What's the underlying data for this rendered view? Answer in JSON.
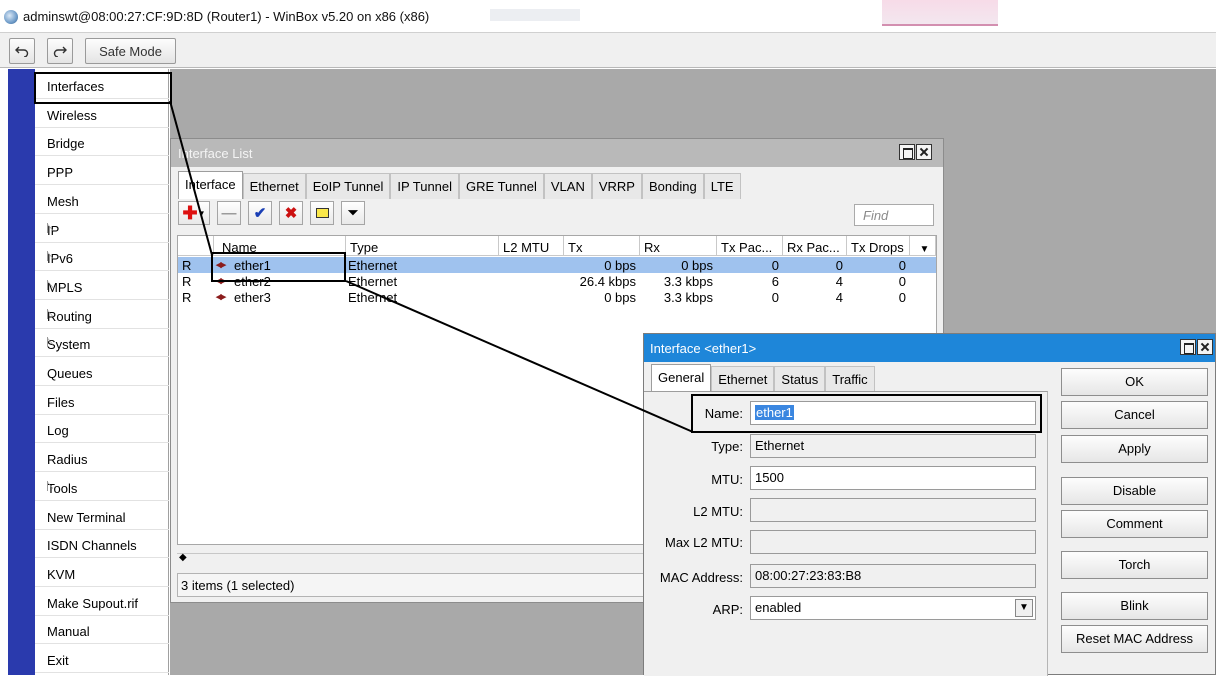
{
  "window": {
    "title": "adminswt@08:00:27:CF:9D:8D (Router1) - WinBox v5.20 on x86 (x86)"
  },
  "toolbar": {
    "undo_icon": "undo-icon",
    "redo_icon": "redo-icon",
    "safe_mode_label": "Safe Mode"
  },
  "sidebar": {
    "items": [
      {
        "label": "Interfaces",
        "submenu": false
      },
      {
        "label": "Wireless",
        "submenu": false
      },
      {
        "label": "Bridge",
        "submenu": false
      },
      {
        "label": "PPP",
        "submenu": false
      },
      {
        "label": "Mesh",
        "submenu": false
      },
      {
        "label": "IP",
        "submenu": true
      },
      {
        "label": "IPv6",
        "submenu": true
      },
      {
        "label": "MPLS",
        "submenu": true
      },
      {
        "label": "Routing",
        "submenu": true
      },
      {
        "label": "System",
        "submenu": true
      },
      {
        "label": "Queues",
        "submenu": false
      },
      {
        "label": "Files",
        "submenu": false
      },
      {
        "label": "Log",
        "submenu": false
      },
      {
        "label": "Radius",
        "submenu": false
      },
      {
        "label": "Tools",
        "submenu": true
      },
      {
        "label": "New Terminal",
        "submenu": false
      },
      {
        "label": "ISDN Channels",
        "submenu": false
      },
      {
        "label": "KVM",
        "submenu": false
      },
      {
        "label": "Make Supout.rif",
        "submenu": false
      },
      {
        "label": "Manual",
        "submenu": false
      },
      {
        "label": "Exit",
        "submenu": false
      }
    ]
  },
  "interface_list": {
    "title": "Interface List",
    "tabs": [
      "Interface",
      "Ethernet",
      "EoIP Tunnel",
      "IP Tunnel",
      "GRE Tunnel",
      "VLAN",
      "VRRP",
      "Bonding",
      "LTE"
    ],
    "find_placeholder": "Find",
    "columns": [
      "Name",
      "Type",
      "L2 MTU",
      "Tx",
      "Rx",
      "Tx Pac...",
      "Rx Pac...",
      "Tx Drops"
    ],
    "rows": [
      {
        "flag": "R",
        "name": "ether1",
        "type": "Ethernet",
        "l2mtu": "",
        "tx": "0 bps",
        "rx": "0 bps",
        "txp": "0",
        "rxp": "0",
        "txd": "0"
      },
      {
        "flag": "R",
        "name": "ether2",
        "type": "Ethernet",
        "l2mtu": "",
        "tx": "26.4 kbps",
        "rx": "3.3 kbps",
        "txp": "6",
        "rxp": "4",
        "txd": "0"
      },
      {
        "flag": "R",
        "name": "ether3",
        "type": "Ethernet",
        "l2mtu": "",
        "tx": "0 bps",
        "rx": "3.3 kbps",
        "txp": "0",
        "rxp": "4",
        "txd": "0"
      }
    ],
    "status": "3 items (1 selected)"
  },
  "interface_dialog": {
    "title": "Interface <ether1>",
    "tabs": [
      "General",
      "Ethernet",
      "Status",
      "Traffic"
    ],
    "fields": {
      "name_label": "Name:",
      "name_value": "ether1",
      "type_label": "Type:",
      "type_value": "Ethernet",
      "mtu_label": "MTU:",
      "mtu_value": "1500",
      "l2mtu_label": "L2 MTU:",
      "l2mtu_value": "",
      "maxl2mtu_label": "Max L2 MTU:",
      "maxl2mtu_value": "",
      "mac_label": "MAC Address:",
      "mac_value": "08:00:27:23:83:B8",
      "arp_label": "ARP:",
      "arp_value": "enabled"
    },
    "buttons": [
      "OK",
      "Cancel",
      "Apply",
      "Disable",
      "Comment",
      "Torch",
      "Blink",
      "Reset MAC Address"
    ]
  },
  "colors": {
    "sidebar_strip": "#2a3aad",
    "selection": "#9fc2ee",
    "dialog_title": "#1e86d9",
    "workspace": "#a9a9a9"
  }
}
